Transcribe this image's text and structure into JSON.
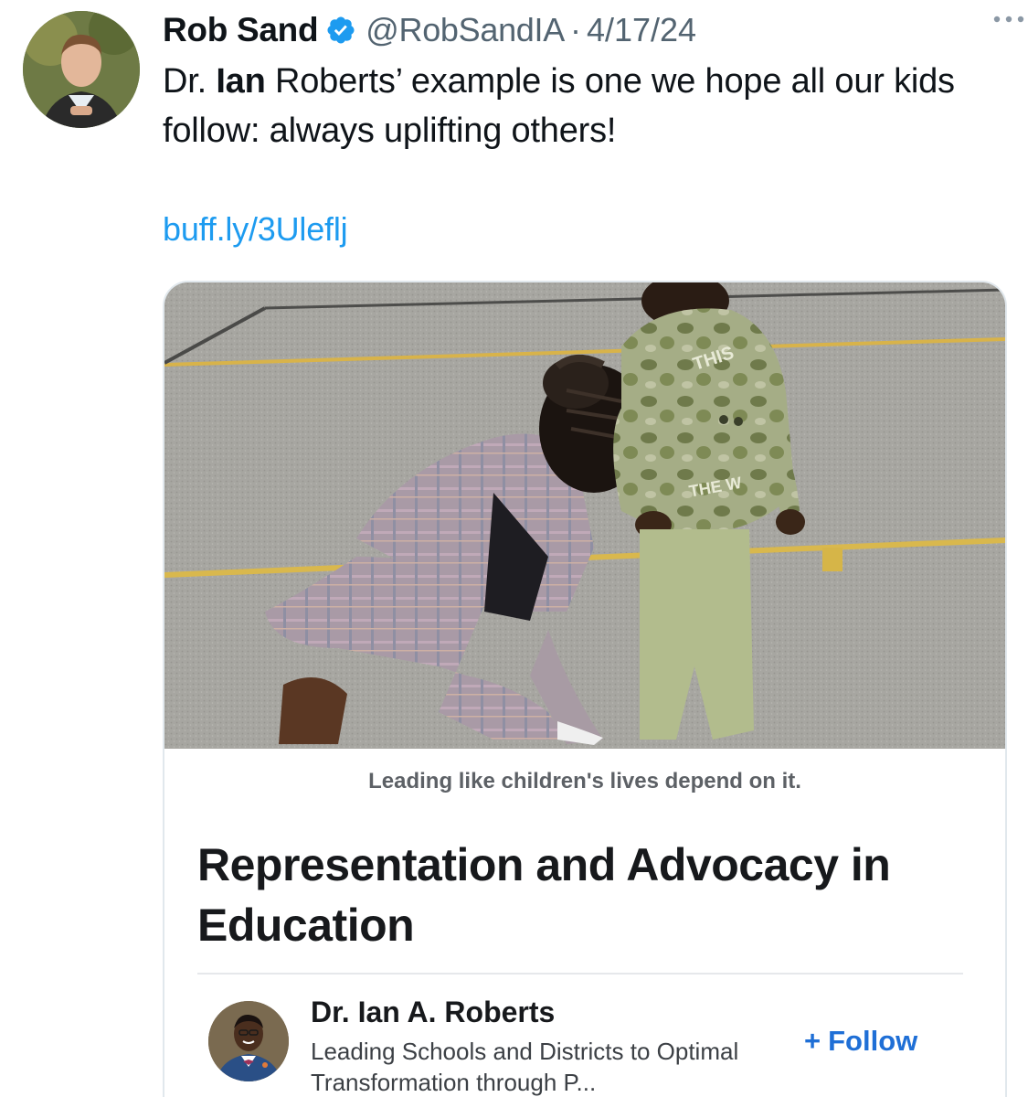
{
  "tweet": {
    "display_name": "Rob Sand",
    "handle": "@RobSandIA",
    "separator": "·",
    "date": "4/17/24",
    "text_prefix": "Dr. ",
    "text_bold": "Ian",
    "text_rest": " Roberts’ example is one we hope all our kids follow: always uplifting others!",
    "link": "buff.ly/3Uleflj"
  },
  "card": {
    "caption": "Leading like children's lives depend on it.",
    "title": "Representation and Advocacy in Education",
    "author_name": "Dr. Ian A. Roberts",
    "author_tagline": "Leading Schools and Districts to Optimal Transformation through P...",
    "follow_plus": "+",
    "follow_label": "Follow"
  },
  "icons": {
    "verified": "verified-badge-icon",
    "more": "more-options-icon"
  },
  "colors": {
    "link": "#1d9bf0",
    "secondary_text": "#536471",
    "follow": "#1f6fd6"
  }
}
